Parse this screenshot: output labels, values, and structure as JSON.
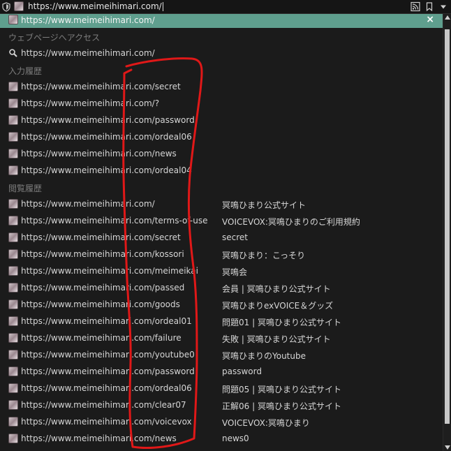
{
  "urlbar": {
    "value": "https://www.meimeihimari.com/",
    "icons": [
      "shield-icon",
      "rss-icon",
      "bookmark-icon",
      "dropdown-arrow-icon"
    ]
  },
  "dropdown": {
    "selected_suggestion": "https://www.meimeihimari.com/",
    "visit_heading": "ウェブページへアクセス",
    "visit_url": "https://www.meimeihimari.com/",
    "input_history_heading": "入力履歴",
    "input_history": [
      {
        "url": "https://www.meimeihimari.com/secret"
      },
      {
        "url": "https://www.meimeihimari.com/?"
      },
      {
        "url": "https://www.meimeihimari.com/password"
      },
      {
        "url": "https://www.meimeihimari.com/ordeal06"
      },
      {
        "url": "https://www.meimeihimari.com/news"
      },
      {
        "url": "https://www.meimeihimari.com/ordeal04"
      }
    ],
    "browse_history_heading": "閲覧履歴",
    "browse_history": [
      {
        "url": "https://www.meimeihimari.com/",
        "title": "冥鳴ひまり公式サイト"
      },
      {
        "url": "https://www.meimeihimari.com/terms-of-use",
        "title": "VOICEVOX:冥鳴ひまりのご利用規約"
      },
      {
        "url": "https://www.meimeihimari.com/secret",
        "title": "secret"
      },
      {
        "url": "https://www.meimeihimari.com/kossori",
        "title": "冥鳴ひまり：こっそり"
      },
      {
        "url": "https://www.meimeihimari.com/meimeikai",
        "title": "冥鳴会"
      },
      {
        "url": "https://www.meimeihimari.com/passed",
        "title": "会員 | 冥鳴ひまり公式サイト"
      },
      {
        "url": "https://www.meimeihimari.com/goods",
        "title": "冥鳴ひまりexVOICE＆グッズ"
      },
      {
        "url": "https://www.meimeihimari.com/ordeal01",
        "title": "問題01 | 冥鳴ひまり公式サイト"
      },
      {
        "url": "https://www.meimeihimari.com/failure",
        "title": "失敗 | 冥鳴ひまり公式サイト"
      },
      {
        "url": "https://www.meimeihimari.com/youtube0",
        "title": "冥鳴ひまりのYoutube"
      },
      {
        "url": "https://www.meimeihimari.com/password",
        "title": "password"
      },
      {
        "url": "https://www.meimeihimari.com/ordeal06",
        "title": "問題05 | 冥鳴ひまり公式サイト"
      },
      {
        "url": "https://www.meimeihimari.com/clear07",
        "title": "正解06 | 冥鳴ひまり公式サイト"
      },
      {
        "url": "https://www.meimeihimari.com/voicevox",
        "title": "VOICEVOX:冥鳴ひまり"
      },
      {
        "url": "https://www.meimeihimari.com/news",
        "title": "news0"
      }
    ]
  },
  "annotation": {
    "color": "#e01818"
  }
}
